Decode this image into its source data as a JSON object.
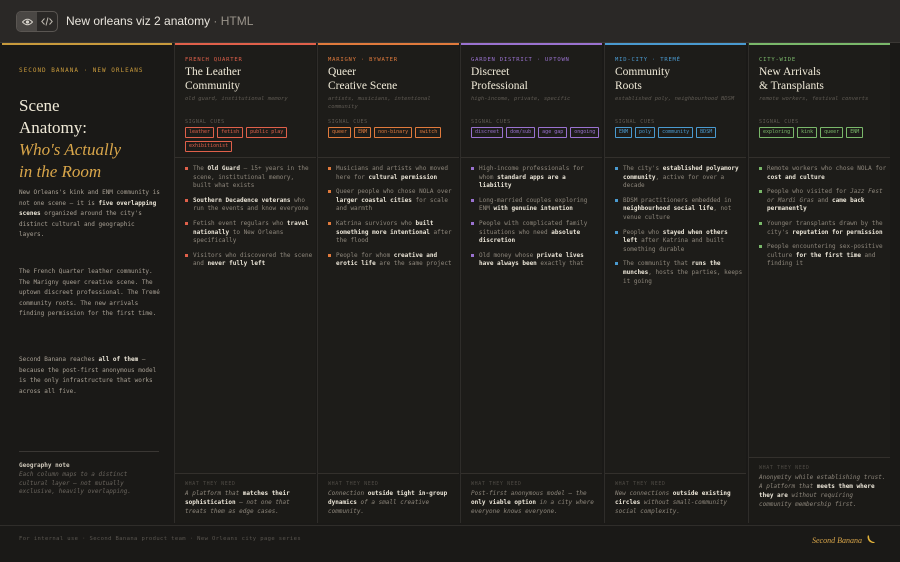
{
  "window": {
    "title": "New orleans viz 2 anatomy",
    "subtitle": " · HTML"
  },
  "toggle": {
    "preview_icon": "eye-icon",
    "code_icon": "code-icon"
  },
  "intro": {
    "eyebrow": "SECOND BANANA · NEW ORLEANS",
    "title_line1": "Scene",
    "title_line2": "Anatomy:",
    "title_em1": "Who's Actually",
    "title_em2": "in the Room",
    "p1": [
      {
        "t": "New Orleans's kink and ENM community is not one scene — it is "
      },
      {
        "t": "five overlapping scenes",
        "b": true
      },
      {
        "t": " organized around the city's distinct cultural and geographic layers."
      }
    ],
    "p2": "The French Quarter leather community. The Marigny queer creative scene. The uptown discreet professional. The Tremé community roots. The new arrivals finding permission for the first time.",
    "p3": [
      {
        "t": "Second Banana reaches "
      },
      {
        "t": "all of them",
        "b": true
      },
      {
        "t": " — because the post-first anonymous model is the only infrastructure that works across all five."
      }
    ],
    "note_title": "Geography note",
    "note_text": "Each column maps to a distinct cultural layer — not mutually exclusive, heavily overlapping."
  },
  "columns": [
    {
      "label": "FRENCH QUARTER",
      "color": "#e0604a",
      "title1": "The Leather",
      "title2": "Community",
      "desc": "old guard, institutional memory",
      "cuehead": "SIGNAL CUES",
      "tags": [
        "leather",
        "fetish",
        "public play",
        "exhibitionist"
      ],
      "bullets": [
        [
          {
            "t": "The "
          },
          {
            "t": "Old Guard",
            "b": true
          },
          {
            "t": " — 15+ years in the scene, institutional memory, built what exists"
          }
        ],
        [
          {
            "t": "Southern Decadence veterans",
            "b": true
          },
          {
            "t": " who run the events and know everyone"
          }
        ],
        [
          {
            "t": "Fetish event regulars who "
          },
          {
            "t": "travel nationally",
            "b": true
          },
          {
            "t": " to New Orleans specifically"
          }
        ],
        [
          {
            "t": "Visitors who discovered the scene and "
          },
          {
            "t": "never fully left",
            "b": true
          }
        ]
      ],
      "foot_head": "WHAT THEY NEED",
      "foot": [
        {
          "t": "A platform that "
        },
        {
          "t": "matches their sophistication",
          "b": true
        },
        {
          "t": " — not one that treats them as edge cases."
        }
      ]
    },
    {
      "label": "MARIGNY · BYWATER",
      "color": "#e07a3c",
      "title1": "Queer",
      "title2": "Creative Scene",
      "desc": "artists, musicians, intentional community",
      "cuehead": "SIGNAL CUES",
      "tags": [
        "queer",
        "ENM",
        "non-binary",
        "switch"
      ],
      "bullets": [
        [
          {
            "t": "Musicians and artists who moved here for "
          },
          {
            "t": "cultural permission",
            "b": true
          }
        ],
        [
          {
            "t": "Queer people who chose NOLA over "
          },
          {
            "t": "larger coastal cities",
            "b": true
          },
          {
            "t": " for scale and warmth"
          }
        ],
        [
          {
            "t": "Katrina survivors who "
          },
          {
            "t": "built something more intentional",
            "b": true
          },
          {
            "t": " after the flood"
          }
        ],
        [
          {
            "t": "People for whom "
          },
          {
            "t": "creative and erotic life",
            "b": true
          },
          {
            "t": " are the same project"
          }
        ]
      ],
      "foot_head": "WHAT THEY NEED",
      "foot": [
        {
          "t": "Connection "
        },
        {
          "t": "outside tight in-group dynamics",
          "b": true
        },
        {
          "t": " of a small creative community."
        }
      ]
    },
    {
      "label": "GARDEN DISTRICT · UPTOWN",
      "color": "#9a72d0",
      "title1": "Discreet",
      "title2": "Professional",
      "desc": "high-income, private, specific",
      "cuehead": "SIGNAL CUES",
      "tags": [
        "discreet",
        "dom/sub",
        "age gap",
        "ongoing"
      ],
      "bullets": [
        [
          {
            "t": "High-income professionals for whom "
          },
          {
            "t": "standard apps are a liability",
            "b": true
          }
        ],
        [
          {
            "t": "Long-married couples exploring ENM "
          },
          {
            "t": "with genuine intention",
            "b": true
          }
        ],
        [
          {
            "t": "People with complicated family situations who need "
          },
          {
            "t": "absolute discretion",
            "b": true
          }
        ],
        [
          {
            "t": "Old money whose "
          },
          {
            "t": "private lives have always been",
            "b": true
          },
          {
            "t": " exactly that"
          }
        ]
      ],
      "foot_head": "WHAT THEY NEED",
      "foot": [
        {
          "t": "Post-first anonymous model — the "
        },
        {
          "t": "only viable option",
          "b": true
        },
        {
          "t": " in a city where everyone knows everyone."
        }
      ]
    },
    {
      "label": "MID-CITY · TREMÉ",
      "color": "#4a9ad0",
      "title1": "Community",
      "title2": "Roots",
      "desc": "established poly, neighbourhood BDSM",
      "cuehead": "SIGNAL CUES",
      "tags": [
        "ENM",
        "poly",
        "community",
        "BDSM"
      ],
      "bullets": [
        [
          {
            "t": "The city's "
          },
          {
            "t": "established polyamory community",
            "b": true
          },
          {
            "t": ", active for over a decade"
          }
        ],
        [
          {
            "t": "BDSM practitioners embedded in "
          },
          {
            "t": "neighbourhood social life",
            "b": true
          },
          {
            "t": ", not venue culture"
          }
        ],
        [
          {
            "t": "People who "
          },
          {
            "t": "stayed when others left",
            "b": true
          },
          {
            "t": " after Katrina and built something durable"
          }
        ],
        [
          {
            "t": "The community that "
          },
          {
            "t": "runs the munches",
            "b": true
          },
          {
            "t": ", hosts the parties, keeps it going"
          }
        ]
      ],
      "foot_head": "WHAT THEY NEED",
      "foot": [
        {
          "t": "New connections "
        },
        {
          "t": "outside existing circles",
          "b": true
        },
        {
          "t": " without small-community social complexity."
        }
      ]
    },
    {
      "label": "CITY-WIDE",
      "color": "#7ab86a",
      "title1": "New Arrivals",
      "title2": "& Transplants",
      "desc": "remote workers, festival converts",
      "cuehead": "SIGNAL CUES",
      "tags": [
        "exploring",
        "kink",
        "queer",
        "ENM"
      ],
      "bullets": [
        [
          {
            "t": "Remote workers who chose NOLA for "
          },
          {
            "t": "cost and culture",
            "b": true
          }
        ],
        [
          {
            "t": "People who visited for "
          },
          {
            "t": "Jazz Fest or Mardi Gras",
            "i": true
          },
          {
            "t": " and "
          },
          {
            "t": "came back permanently",
            "b": true
          }
        ],
        [
          {
            "t": "Younger transplants drawn by the city's "
          },
          {
            "t": "reputation for permission",
            "b": true
          }
        ],
        [
          {
            "t": "People encountering sex-positive culture "
          },
          {
            "t": "for the first time",
            "b": true
          },
          {
            "t": " and finding it"
          }
        ]
      ],
      "foot_head": "WHAT THEY NEED",
      "foot": [
        {
          "t": "Anonymity while establishing trust. A platform that "
        },
        {
          "t": "meets them where they are",
          "b": true
        },
        {
          "t": " without requiring community membership first."
        }
      ]
    }
  ],
  "footer": {
    "left": "For internal use · Second Banana product team · New Orleans city page series",
    "brand": "Second Banana",
    "brand_icon": "banana-icon"
  }
}
